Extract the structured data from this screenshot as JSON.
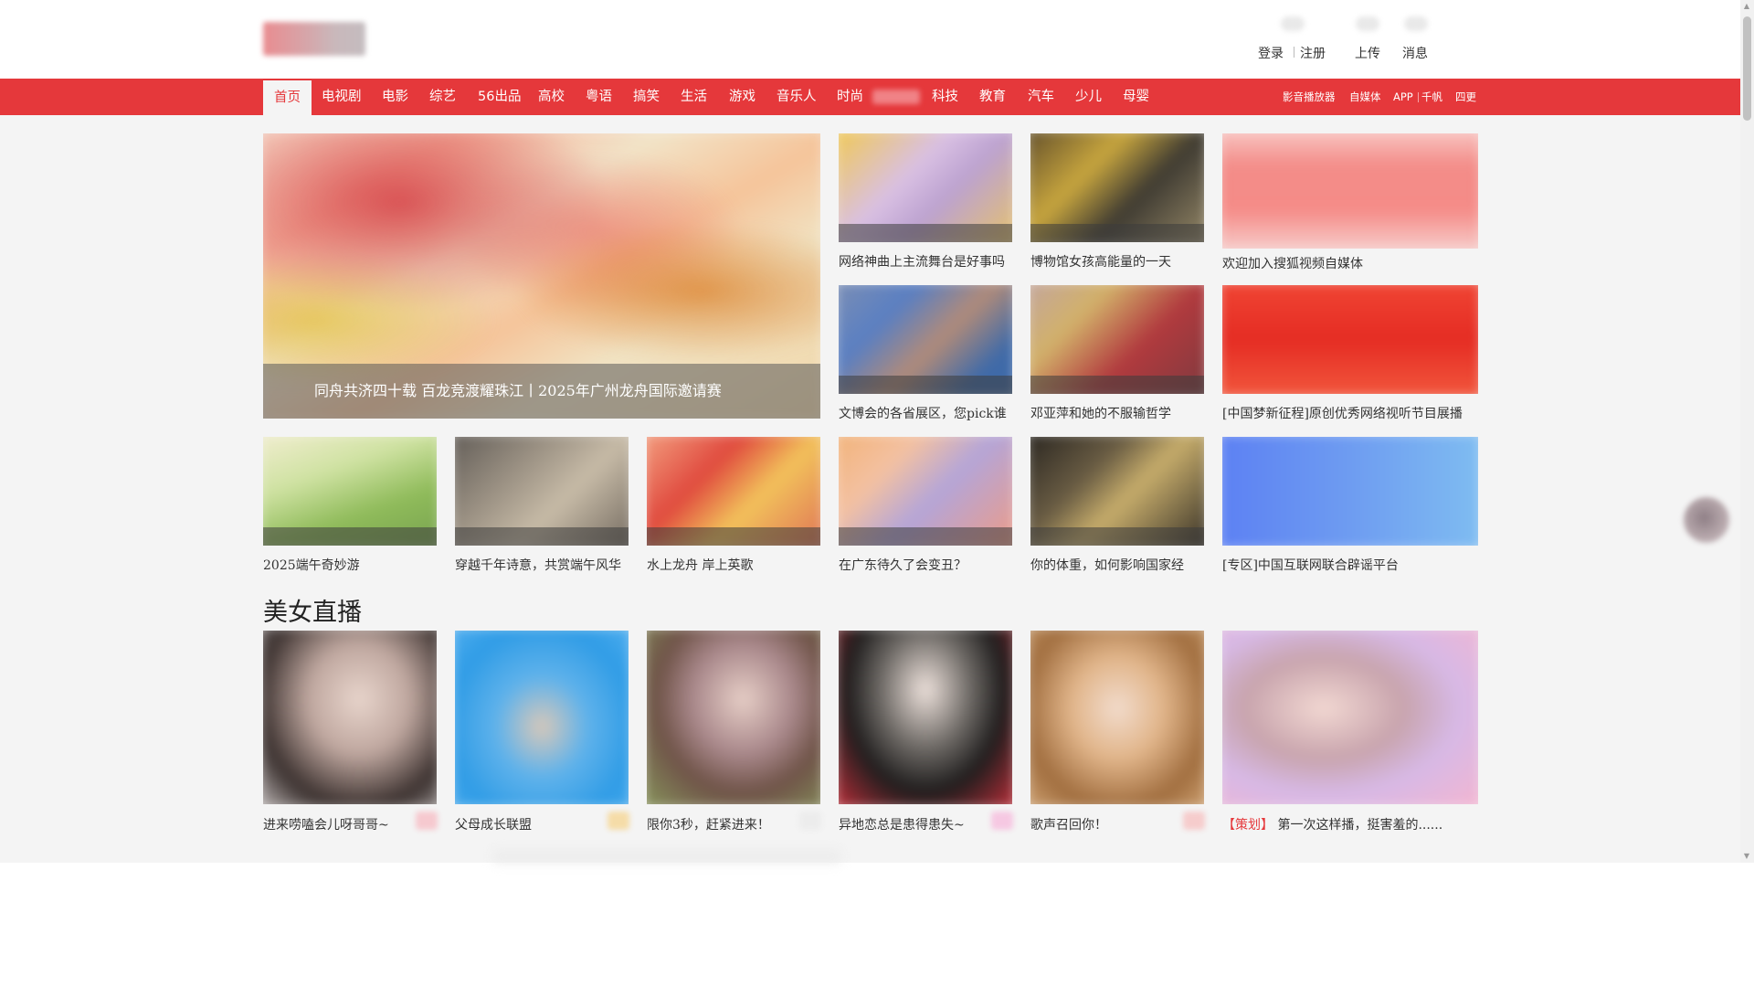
{
  "header": {
    "login": "登录",
    "register": "注册",
    "upload": "上传",
    "messages": "消息"
  },
  "nav": {
    "items": [
      {
        "label": "首页",
        "active": true
      },
      {
        "label": "电视剧"
      },
      {
        "label": "电影"
      },
      {
        "label": "综艺"
      },
      {
        "label": "56出品"
      },
      {
        "label": "高校"
      },
      {
        "label": "粤语"
      },
      {
        "label": "搞笑"
      },
      {
        "label": "生活"
      },
      {
        "label": "游戏"
      },
      {
        "label": "音乐人"
      },
      {
        "label": "时尚"
      },
      {
        "label": "科技"
      },
      {
        "label": "教育"
      },
      {
        "label": "汽车"
      },
      {
        "label": "少儿"
      },
      {
        "label": "母婴"
      }
    ],
    "right": [
      "影音播放器",
      "自媒体",
      "APP",
      "千帆",
      "四更"
    ]
  },
  "hero": {
    "caption": "同舟共济四十载 百龙竞渡耀珠江丨2025年广州龙舟国际邀请赛"
  },
  "grid_row1": [
    {
      "title": "网络神曲上主流舞台是好事吗"
    },
    {
      "title": "博物馆女孩高能量的一天"
    },
    {
      "title": "欢迎加入搜狐视频自媒体"
    }
  ],
  "grid_row2": [
    {
      "title": "文博会的各省展区，您pick谁"
    },
    {
      "title": "邓亚萍和她的不服输哲学"
    },
    {
      "title": "[中国梦新征程]原创优秀网络视听节目展播"
    }
  ],
  "grid_row3": [
    {
      "title": "2025端午奇妙游"
    },
    {
      "title": "穿越千年诗意，共赏端午风华"
    },
    {
      "title": "水上龙舟 岸上英歌"
    },
    {
      "title": "在广东待久了会变丑？"
    },
    {
      "title": "你的体重，如何影响国家经"
    },
    {
      "title": "[专区]中国互联网联合辟谣平台"
    }
  ],
  "live_section": {
    "title": "美女直播",
    "items": [
      {
        "title": "进来唠嗑会儿呀哥哥~"
      },
      {
        "title": "父母成长联盟"
      },
      {
        "title": "限你3秒，赶紧进来！"
      },
      {
        "title": "异地恋总是患得患失~"
      },
      {
        "title": "歌声召回你！"
      },
      {
        "tag": "【策划】",
        "title": "第一次这样播，挺害羞的......"
      }
    ]
  },
  "colors": {
    "brand_red": "#e5383b",
    "page_bg": "#f4f4f4"
  },
  "icons": [
    "logo",
    "user-icon",
    "upload-icon",
    "message-icon",
    "floating-avatar-icon"
  ]
}
